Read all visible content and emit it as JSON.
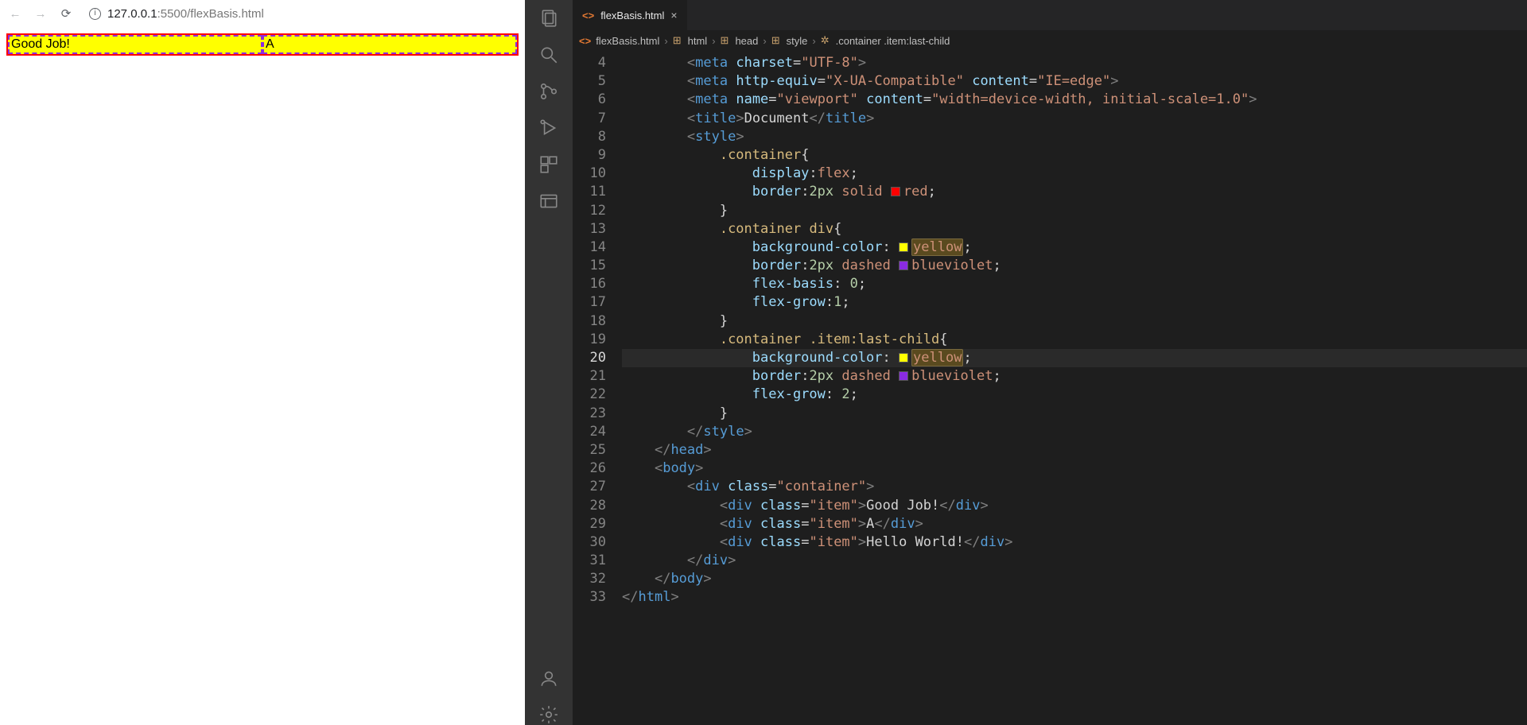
{
  "browser": {
    "url_host": "127.0.0.1",
    "url_port": ":5500",
    "url_path": "/flexBasis.html",
    "items": [
      "Good Job!",
      "A",
      ""
    ]
  },
  "vscode": {
    "tab_name": "flexBasis.html",
    "breadcrumbs": [
      "flexBasis.html",
      "html",
      "head",
      "style",
      ".container .item:last-child"
    ],
    "line_start": 4,
    "highlight_line": 20,
    "code_lines": [
      {
        "n": 4,
        "indent": 8,
        "tokens": [
          [
            "br",
            "<"
          ],
          [
            "tag",
            "meta"
          ],
          [
            "txt",
            " "
          ],
          [
            "attr",
            "charset"
          ],
          [
            "punc",
            "="
          ],
          [
            "str",
            "\"UTF-8\""
          ],
          [
            "br",
            ">"
          ]
        ]
      },
      {
        "n": 5,
        "indent": 8,
        "tokens": [
          [
            "br",
            "<"
          ],
          [
            "tag",
            "meta"
          ],
          [
            "txt",
            " "
          ],
          [
            "attr",
            "http-equiv"
          ],
          [
            "punc",
            "="
          ],
          [
            "str",
            "\"X-UA-Compatible\""
          ],
          [
            "txt",
            " "
          ],
          [
            "attr",
            "content"
          ],
          [
            "punc",
            "="
          ],
          [
            "str",
            "\"IE=edge\""
          ],
          [
            "br",
            ">"
          ]
        ]
      },
      {
        "n": 6,
        "indent": 8,
        "tokens": [
          [
            "br",
            "<"
          ],
          [
            "tag",
            "meta"
          ],
          [
            "txt",
            " "
          ],
          [
            "attr",
            "name"
          ],
          [
            "punc",
            "="
          ],
          [
            "str",
            "\"viewport\""
          ],
          [
            "txt",
            " "
          ],
          [
            "attr",
            "content"
          ],
          [
            "punc",
            "="
          ],
          [
            "str",
            "\"width=device-width, initial-scale=1.0\""
          ],
          [
            "br",
            ">"
          ]
        ]
      },
      {
        "n": 7,
        "indent": 8,
        "tokens": [
          [
            "br",
            "<"
          ],
          [
            "tag",
            "title"
          ],
          [
            "br",
            ">"
          ],
          [
            "txt",
            "Document"
          ],
          [
            "br",
            "</"
          ],
          [
            "tag",
            "title"
          ],
          [
            "br",
            ">"
          ]
        ]
      },
      {
        "n": 8,
        "indent": 8,
        "tokens": [
          [
            "br",
            "<"
          ],
          [
            "tag",
            "style"
          ],
          [
            "br",
            ">"
          ]
        ]
      },
      {
        "n": 9,
        "indent": 12,
        "tokens": [
          [
            "sel",
            ".container"
          ],
          [
            "punc",
            "{"
          ]
        ]
      },
      {
        "n": 10,
        "indent": 16,
        "tokens": [
          [
            "prop",
            "display"
          ],
          [
            "punc",
            ":"
          ],
          [
            "val",
            "flex"
          ],
          [
            "punc",
            ";"
          ]
        ]
      },
      {
        "n": 11,
        "indent": 16,
        "tokens": [
          [
            "prop",
            "border"
          ],
          [
            "punc",
            ":"
          ],
          [
            "num",
            "2px"
          ],
          [
            "txt",
            " "
          ],
          [
            "val",
            "solid"
          ],
          [
            "txt",
            " "
          ],
          [
            "swatch",
            "red"
          ],
          [
            "val",
            "red"
          ],
          [
            "punc",
            ";"
          ]
        ]
      },
      {
        "n": 12,
        "indent": 12,
        "tokens": [
          [
            "punc",
            "}"
          ]
        ]
      },
      {
        "n": 13,
        "indent": 12,
        "tokens": [
          [
            "sel",
            ".container"
          ],
          [
            "txt",
            " "
          ],
          [
            "sel",
            "div"
          ],
          [
            "punc",
            "{"
          ]
        ]
      },
      {
        "n": 14,
        "indent": 16,
        "tokens": [
          [
            "prop",
            "background-color"
          ],
          [
            "punc",
            ": "
          ],
          [
            "swatch",
            "yellow"
          ],
          [
            "valhl",
            "yellow"
          ],
          [
            "punc",
            ";"
          ]
        ]
      },
      {
        "n": 15,
        "indent": 16,
        "tokens": [
          [
            "prop",
            "border"
          ],
          [
            "punc",
            ":"
          ],
          [
            "num",
            "2px"
          ],
          [
            "txt",
            " "
          ],
          [
            "val",
            "dashed"
          ],
          [
            "txt",
            " "
          ],
          [
            "swatch",
            "blueviolet"
          ],
          [
            "val",
            "blueviolet"
          ],
          [
            "punc",
            ";"
          ]
        ]
      },
      {
        "n": 16,
        "indent": 16,
        "tokens": [
          [
            "prop",
            "flex-basis"
          ],
          [
            "punc",
            ": "
          ],
          [
            "num",
            "0"
          ],
          [
            "punc",
            ";"
          ]
        ]
      },
      {
        "n": 17,
        "indent": 16,
        "tokens": [
          [
            "prop",
            "flex-grow"
          ],
          [
            "punc",
            ":"
          ],
          [
            "num",
            "1"
          ],
          [
            "punc",
            ";"
          ]
        ]
      },
      {
        "n": 18,
        "indent": 12,
        "tokens": [
          [
            "punc",
            "}"
          ]
        ]
      },
      {
        "n": 19,
        "indent": 12,
        "tokens": [
          [
            "sel",
            ".container"
          ],
          [
            "txt",
            " "
          ],
          [
            "sel",
            ".item:last-child"
          ],
          [
            "punc",
            "{"
          ]
        ]
      },
      {
        "n": 20,
        "indent": 16,
        "tokens": [
          [
            "prop",
            "background-color"
          ],
          [
            "punc",
            ": "
          ],
          [
            "swatch",
            "yellow"
          ],
          [
            "valhl",
            "yellow"
          ],
          [
            "punc",
            ";"
          ]
        ]
      },
      {
        "n": 21,
        "indent": 16,
        "tokens": [
          [
            "prop",
            "border"
          ],
          [
            "punc",
            ":"
          ],
          [
            "num",
            "2px"
          ],
          [
            "txt",
            " "
          ],
          [
            "val",
            "dashed"
          ],
          [
            "txt",
            " "
          ],
          [
            "swatch",
            "blueviolet"
          ],
          [
            "val",
            "blueviolet"
          ],
          [
            "punc",
            ";"
          ]
        ]
      },
      {
        "n": 22,
        "indent": 16,
        "tokens": [
          [
            "prop",
            "flex-grow"
          ],
          [
            "punc",
            ": "
          ],
          [
            "num",
            "2"
          ],
          [
            "punc",
            ";"
          ]
        ]
      },
      {
        "n": 23,
        "indent": 12,
        "tokens": [
          [
            "punc",
            "}"
          ]
        ]
      },
      {
        "n": 24,
        "indent": 8,
        "tokens": [
          [
            "br",
            "</"
          ],
          [
            "tag",
            "style"
          ],
          [
            "br",
            ">"
          ]
        ]
      },
      {
        "n": 25,
        "indent": 4,
        "tokens": [
          [
            "br",
            "</"
          ],
          [
            "tag",
            "head"
          ],
          [
            "br",
            ">"
          ]
        ]
      },
      {
        "n": 26,
        "indent": 4,
        "tokens": [
          [
            "br",
            "<"
          ],
          [
            "tag",
            "body"
          ],
          [
            "br",
            ">"
          ]
        ]
      },
      {
        "n": 27,
        "indent": 8,
        "tokens": [
          [
            "br",
            "<"
          ],
          [
            "tag",
            "div"
          ],
          [
            "txt",
            " "
          ],
          [
            "attr",
            "class"
          ],
          [
            "punc",
            "="
          ],
          [
            "str",
            "\"container\""
          ],
          [
            "br",
            ">"
          ]
        ]
      },
      {
        "n": 28,
        "indent": 12,
        "tokens": [
          [
            "br",
            "<"
          ],
          [
            "tag",
            "div"
          ],
          [
            "txt",
            " "
          ],
          [
            "attr",
            "class"
          ],
          [
            "punc",
            "="
          ],
          [
            "str",
            "\"item\""
          ],
          [
            "br",
            ">"
          ],
          [
            "txt",
            "Good Job!"
          ],
          [
            "br",
            "</"
          ],
          [
            "tag",
            "div"
          ],
          [
            "br",
            ">"
          ]
        ]
      },
      {
        "n": 29,
        "indent": 12,
        "tokens": [
          [
            "br",
            "<"
          ],
          [
            "tag",
            "div"
          ],
          [
            "txt",
            " "
          ],
          [
            "attr",
            "class"
          ],
          [
            "punc",
            "="
          ],
          [
            "str",
            "\"item\""
          ],
          [
            "br",
            ">"
          ],
          [
            "txt",
            "A"
          ],
          [
            "br",
            "</"
          ],
          [
            "tag",
            "div"
          ],
          [
            "br",
            ">"
          ]
        ]
      },
      {
        "n": 30,
        "indent": 12,
        "tokens": [
          [
            "br",
            "<"
          ],
          [
            "tag",
            "div"
          ],
          [
            "txt",
            " "
          ],
          [
            "attr",
            "class"
          ],
          [
            "punc",
            "="
          ],
          [
            "str",
            "\"item\""
          ],
          [
            "br",
            ">"
          ],
          [
            "txt",
            "Hello World!"
          ],
          [
            "br",
            "</"
          ],
          [
            "tag",
            "div"
          ],
          [
            "br",
            ">"
          ]
        ]
      },
      {
        "n": 31,
        "indent": 8,
        "tokens": [
          [
            "br",
            "</"
          ],
          [
            "tag",
            "div"
          ],
          [
            "br",
            ">"
          ]
        ]
      },
      {
        "n": 32,
        "indent": 4,
        "tokens": [
          [
            "br",
            "</"
          ],
          [
            "tag",
            "body"
          ],
          [
            "br",
            ">"
          ]
        ]
      },
      {
        "n": 33,
        "indent": 0,
        "tokens": [
          [
            "br",
            "</"
          ],
          [
            "tag",
            "html"
          ],
          [
            "br",
            ">"
          ]
        ]
      }
    ]
  }
}
